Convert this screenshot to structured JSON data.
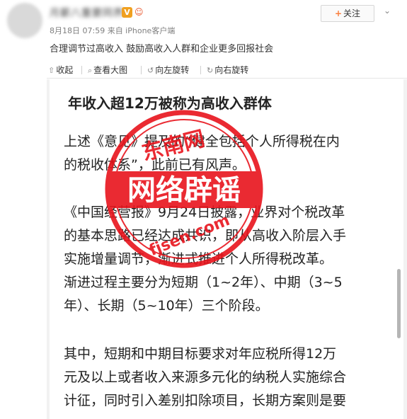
{
  "post": {
    "author": "月薪八重要同界",
    "v_badge": "V",
    "member_badge": "☺",
    "meta": "8月18日 07:59 来自 iPhone客户端",
    "text": "合理调节过高收入 鼓励高收入人群和企业更多回报社会"
  },
  "header": {
    "follow_label": "关注",
    "follow_plus": "+",
    "menu_icon": "chevron-down-icon"
  },
  "toolbar": {
    "collapse_label": "收起",
    "view_large_label": "查看大图",
    "rotate_left_label": "向左旋转",
    "rotate_right_label": "向右旋转"
  },
  "article": {
    "heading": "年收入超12万被称为高收入群体",
    "p1": [
      "上述《意见》提及的“健全包括个人所得税在内",
      "的税收体系”，此前已有风声。"
    ],
    "p2": [
      "《中国经营报》9月24日披露，业界对个税改革",
      "的基本思路已经达成共识，即从高收入阶层入手",
      "实施增量调节，渐进式推进个人所得税改革。",
      "渐进过程主要分为短期（1~2年）、中期（3~5",
      "年）、长期（5~10年）三个阶段。"
    ],
    "p3": [
      "其中，短期和中期目标要求对年应税所得12万",
      "元及以上或者收入来源多元化的纳税人实施综合",
      "计征，同时引入差别扣除项目，长期方案则是要"
    ]
  },
  "stamp": {
    "top_text": "东南网",
    "center_text": "网络辟谣",
    "bottom_text": "fjsen.com",
    "color": "#e8141c"
  }
}
